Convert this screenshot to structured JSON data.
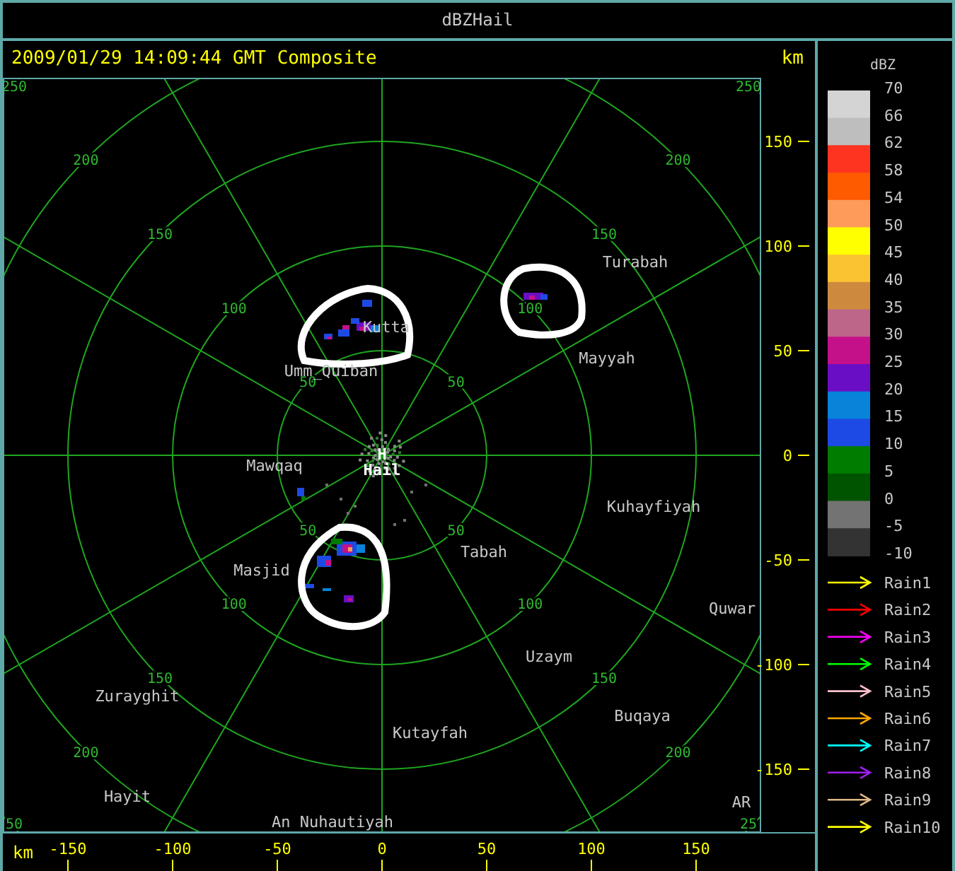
{
  "window": {
    "title": "dBZHail"
  },
  "header": {
    "timestamp": "2009/01/29 14:09:44 GMT Composite",
    "unit": "km"
  },
  "range_rings": [
    {
      "labels": [
        "50",
        "50",
        "50",
        "50"
      ]
    },
    {
      "labels": [
        "100",
        "100",
        "100",
        "100"
      ]
    },
    {
      "labels": [
        "150",
        "150",
        "150",
        "150"
      ]
    },
    {
      "labels": [
        "200",
        "200",
        "200",
        "200"
      ]
    },
    {
      "labels": [
        "250",
        "250",
        "50",
        "25"
      ]
    }
  ],
  "places": [
    {
      "name": "Turabah",
      "kind": "town"
    },
    {
      "name": "Kutta",
      "kind": "town"
    },
    {
      "name": "Umm_Quiban",
      "kind": "town"
    },
    {
      "name": "Mayyah",
      "kind": "town"
    },
    {
      "name": "Mawqaq",
      "kind": "town"
    },
    {
      "name": "H",
      "kind": "radar"
    },
    {
      "name": "Hail",
      "kind": "radar"
    },
    {
      "name": "Kuhayfiyah",
      "kind": "town"
    },
    {
      "name": "Tabah",
      "kind": "town"
    },
    {
      "name": "Masjid",
      "kind": "town"
    },
    {
      "name": "Quwar",
      "kind": "town"
    },
    {
      "name": "Uzaym",
      "kind": "town"
    },
    {
      "name": "Zurayghit",
      "kind": "town"
    },
    {
      "name": "Buqaya",
      "kind": "town"
    },
    {
      "name": "Kutayfah",
      "kind": "town"
    },
    {
      "name": "Hayit",
      "kind": "town"
    },
    {
      "name": "An Nuhautiyah",
      "kind": "town"
    },
    {
      "name": "AR",
      "kind": "town"
    }
  ],
  "y_axis": {
    "ticks": [
      "150",
      "100",
      "50",
      "0",
      "-50",
      "-100",
      "-150"
    ]
  },
  "x_axis": {
    "unit": "km",
    "ticks": [
      "-150",
      "-100",
      "-50",
      "0",
      "50",
      "100",
      "150"
    ]
  },
  "dbz_legend": {
    "title": "dBZ",
    "labels": [
      "70",
      "66",
      "62",
      "58",
      "54",
      "50",
      "45",
      "40",
      "35",
      "30",
      "25",
      "20",
      "15",
      "10",
      "5",
      "0",
      "-5",
      "-10"
    ],
    "bins": [
      {
        "color": "#d4d4d4"
      },
      {
        "color": "#bebebe"
      },
      {
        "color": "#fe3320"
      },
      {
        "color": "#fe5a00"
      },
      {
        "color": "#fe9a5a"
      },
      {
        "color": "#ffff00"
      },
      {
        "color": "#f9c331"
      },
      {
        "color": "#cd8a3f"
      },
      {
        "color": "#bd6689"
      },
      {
        "color": "#c41189"
      },
      {
        "color": "#6a0ec5"
      },
      {
        "color": "#0883d9"
      },
      {
        "color": "#1d4ae4"
      },
      {
        "color": "#007c00"
      },
      {
        "color": "#005400"
      },
      {
        "color": "#737373"
      },
      {
        "color": "#333333"
      }
    ]
  },
  "tracks": [
    {
      "label": "Rain1",
      "color": "#ffff00"
    },
    {
      "label": "Rain2",
      "color": "#ff0000"
    },
    {
      "label": "Rain3",
      "color": "#ff00ff"
    },
    {
      "label": "Rain4",
      "color": "#00ff00"
    },
    {
      "label": "Rain5",
      "color": "#ffc0cb"
    },
    {
      "label": "Rain6",
      "color": "#ffa500"
    },
    {
      "label": "Rain7",
      "color": "#00ffff"
    },
    {
      "label": "Rain8",
      "color": "#a020f0"
    },
    {
      "label": "Rain9",
      "color": "#deb887"
    },
    {
      "label": "Rain10",
      "color": "#ffff00"
    }
  ]
}
